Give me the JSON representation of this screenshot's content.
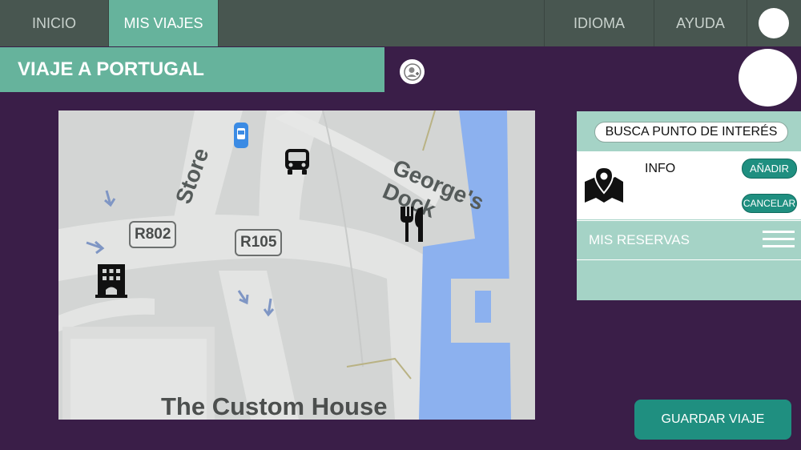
{
  "nav": {
    "inicio": "INICIO",
    "mis_viajes": "MIS VIAJES",
    "idioma": "IDIOMA",
    "ayuda": "AYUDA"
  },
  "title": "VIAJE A PORTUGAL",
  "map": {
    "street_label": "Store",
    "dock_label": "George's Dock",
    "road_1": "R802",
    "road_2": "R105",
    "place_label": "The Custom House",
    "pois": [
      "bus-icon",
      "restaurant-icon",
      "hotel-icon",
      "bus-stop-icon"
    ]
  },
  "panel": {
    "search": "BUSCA PUNTO DE INTERÉS",
    "info": "INFO",
    "add": "AÑADIR",
    "cancel": "CANCELAR",
    "reservations": "MIS RESERVAS"
  },
  "save": "GUARDAR VIAJE",
  "colors": {
    "background": "#3a1e48",
    "nav": "#485650",
    "accent": "#66b39c",
    "panel": "#a5d3c6",
    "button": "#1f8f80",
    "water": "#8cb1ef"
  }
}
